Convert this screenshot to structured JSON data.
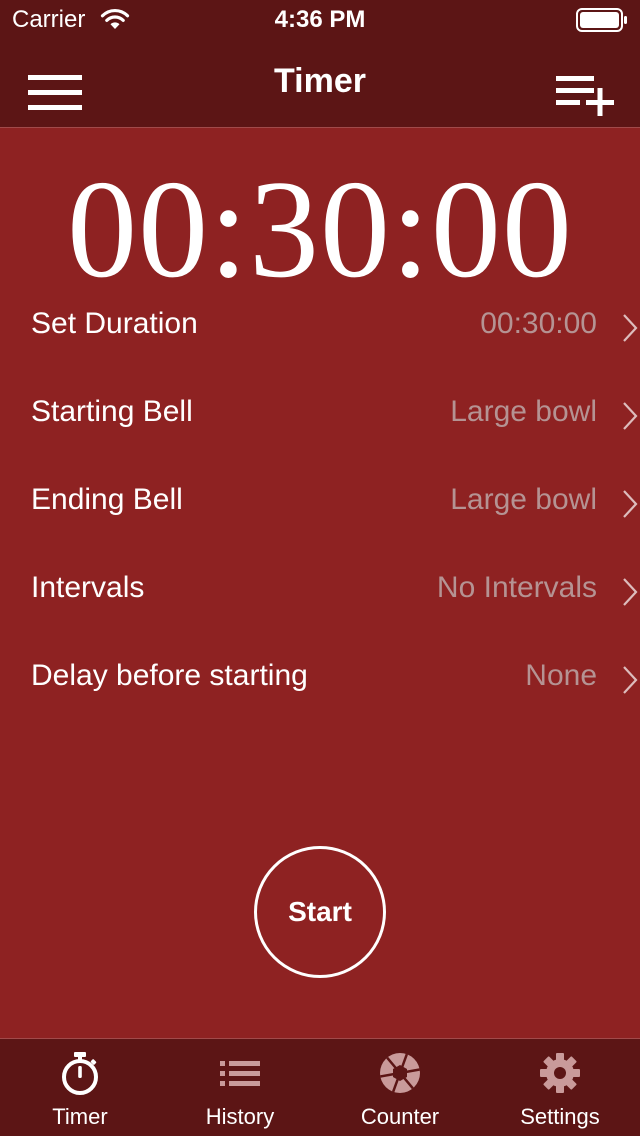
{
  "status_bar": {
    "carrier": "Carrier",
    "time": "4:36 PM"
  },
  "nav": {
    "title": "Timer",
    "left_icon": "menu-icon",
    "right_icon": "add-to-list-icon"
  },
  "timer": {
    "display": "00:30:00"
  },
  "settings": [
    {
      "label": "Set Duration",
      "value": "00:30:00"
    },
    {
      "label": "Starting Bell",
      "value": "Large bowl"
    },
    {
      "label": "Ending Bell",
      "value": "Large bowl"
    },
    {
      "label": "Intervals",
      "value": "No Intervals"
    },
    {
      "label": "Delay before starting",
      "value": "None"
    }
  ],
  "start_button": {
    "label": "Start"
  },
  "tabs": [
    {
      "label": "Timer",
      "icon": "stopwatch-icon",
      "active": true
    },
    {
      "label": "History",
      "icon": "list-icon",
      "active": false
    },
    {
      "label": "Counter",
      "icon": "aperture-icon",
      "active": false
    },
    {
      "label": "Settings",
      "icon": "gear-icon",
      "active": false
    }
  ],
  "colors": {
    "background": "#8e2222",
    "bar": "#5c1515",
    "value_text": "#b59393",
    "inactive_icon": "#c99a9a"
  }
}
